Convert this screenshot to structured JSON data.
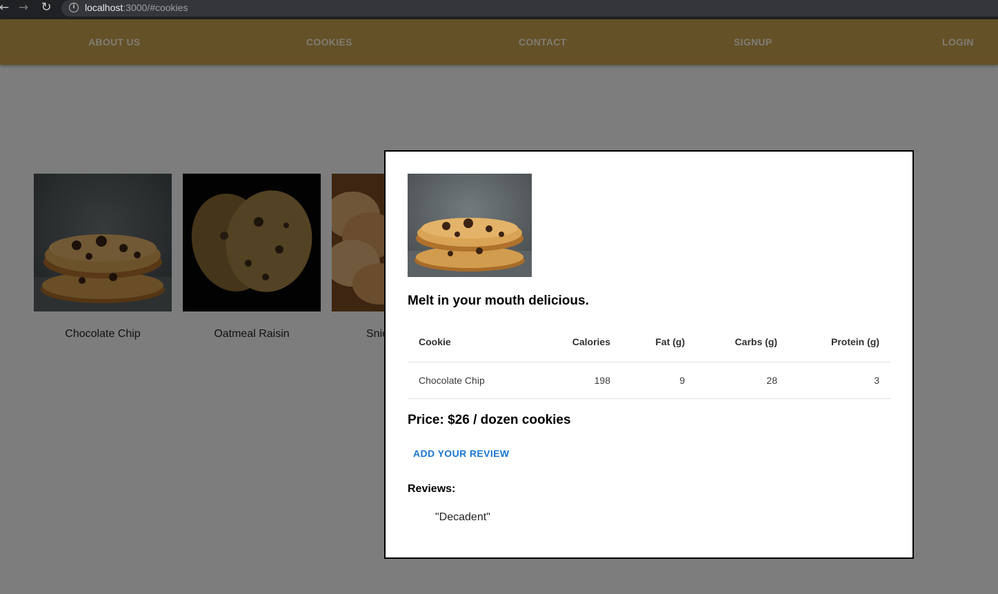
{
  "browser": {
    "url_host": "localhost",
    "url_rest": ":3000/#cookies"
  },
  "nav": {
    "items": [
      "ABOUT US",
      "COOKIES",
      "CONTACT",
      "SIGNUP",
      "LOGIN"
    ]
  },
  "cookies": [
    {
      "name": "Chocolate Chip"
    },
    {
      "name": "Oatmeal Raisin"
    },
    {
      "name": "Snic"
    }
  ],
  "modal": {
    "tagline": "Melt in your mouth delicious.",
    "table": {
      "headers": [
        "Cookie",
        "Calories",
        "Fat (g)",
        "Carbs (g)",
        "Protein (g)"
      ],
      "rows": [
        [
          "Chocolate Chip",
          "198",
          "9",
          "28",
          "3"
        ]
      ]
    },
    "price": "Price: $26 / dozen cookies",
    "review_button": "ADD YOUR REVIEW",
    "reviews_heading": "Reviews:",
    "reviews": [
      "\"Decadent\""
    ]
  },
  "colors": {
    "app_bar": "#cba250",
    "accent": "#1976d2"
  },
  "icons": {
    "back": "back-arrow-icon",
    "forward": "forward-arrow-icon",
    "reload": "reload-icon",
    "site_info": "info-icon"
  }
}
